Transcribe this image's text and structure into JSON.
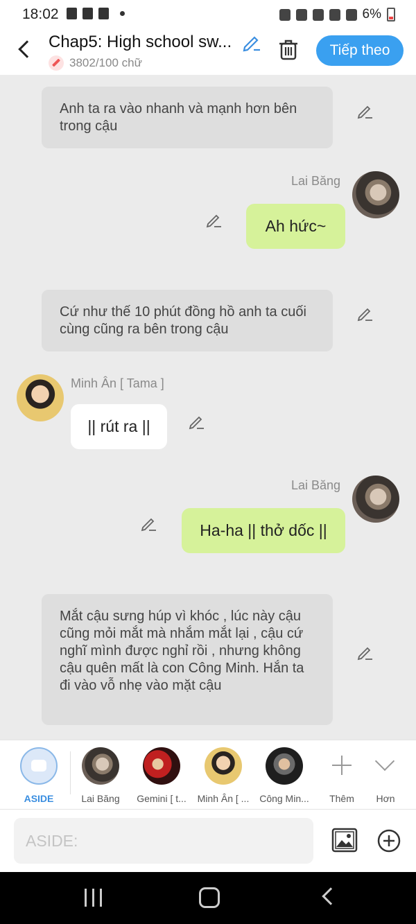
{
  "status_bar": {
    "time": "18:02",
    "battery": "6%"
  },
  "header": {
    "title": "Chap5: High school sw...",
    "word_count": "3802/100 chữ",
    "next_button": "Tiếp theo"
  },
  "messages": [
    {
      "type": "narration",
      "text": "Anh ta ra vào nhanh và mạnh hơn bên trong cậu"
    },
    {
      "type": "right",
      "speaker": "Lai Băng",
      "text": "Ah hức~"
    },
    {
      "type": "narration",
      "text": "Cứ như thế 10 phút đồng hồ anh ta cuối cùng cũng ra bên trong cậu"
    },
    {
      "type": "left",
      "speaker": "Minh Ân [ Tama ]",
      "text": "|| rút ra ||"
    },
    {
      "type": "right",
      "speaker": "Lai Băng",
      "text": "Ha-ha || thở dốc ||"
    },
    {
      "type": "narration",
      "text": "Mắt cậu sưng húp vì khóc , lúc này cậu cũng mỏi mắt mà nhắm mắt lại , cậu cứ nghĩ mình được nghỉ rồi , nhưng không cậu quên mất là con Công Minh. Hắn ta đi vào vỗ nhẹ vào mặt cậu"
    }
  ],
  "characters": [
    {
      "label": "ASIDE"
    },
    {
      "label": "Lai Băng"
    },
    {
      "label": "Gemini [ t..."
    },
    {
      "label": "Minh Ân [ ..."
    },
    {
      "label": "Công Min..."
    }
  ],
  "char_actions": {
    "more": "Thêm",
    "collapse": "Hơn"
  },
  "input": {
    "placeholder": "ASIDE:",
    "value": ""
  },
  "colors": {
    "accent": "#3aa0f0",
    "right_bubble": "#d6f29a",
    "narration_bg": "#dedede",
    "chat_bg": "#ebebeb"
  },
  "icons": [
    "back-icon",
    "pencil-icon",
    "trash-icon",
    "image-icon",
    "add-circle-icon",
    "plus-icon",
    "chevron-down-icon"
  ]
}
